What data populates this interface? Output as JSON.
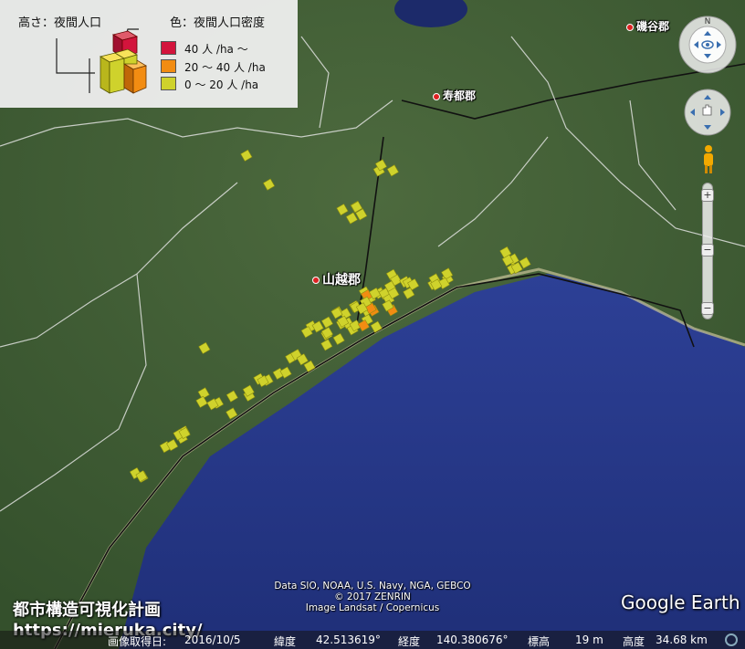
{
  "legend": {
    "height_title": "高さ：夜間人口",
    "color_title": "色：夜間人口密度",
    "items": [
      {
        "label": "40 人 /ha ～",
        "color": "#d3143c"
      },
      {
        "label": "20 ～ 40 人 /ha",
        "color": "#f28c12"
      },
      {
        "label": "0 ～ 20 人 /ha",
        "color": "#cfd22c"
      }
    ]
  },
  "places": {
    "isoya": "磯谷郡",
    "suttsu": "寿都郡",
    "yamakoshi": "山越郡"
  },
  "attribution": {
    "line1": "Data SIO, NOAA, U.S. Navy, NGA, GEBCO",
    "line2": "© 2017 ZENRIN",
    "line3": "Image Landsat / Copernicus"
  },
  "brand": "Google Earth",
  "site": {
    "name": "都市構造可視化計画",
    "url": "https://mieruka.city/"
  },
  "status": {
    "date_label": "画像取得日:",
    "date": "2016/10/5",
    "lat_label": "緯度",
    "lat": "42.513619°",
    "lon_label": "経度",
    "lon": "140.380676°",
    "elev_label": "標高",
    "elev": "19 m",
    "alt_label": "高度",
    "alt": "34.68 km"
  },
  "colors": {
    "sea": "#27398a",
    "land": "#3e5a34",
    "block_low": "#cfd22c",
    "block_mid": "#f28c12",
    "block_high": "#d3143c"
  }
}
